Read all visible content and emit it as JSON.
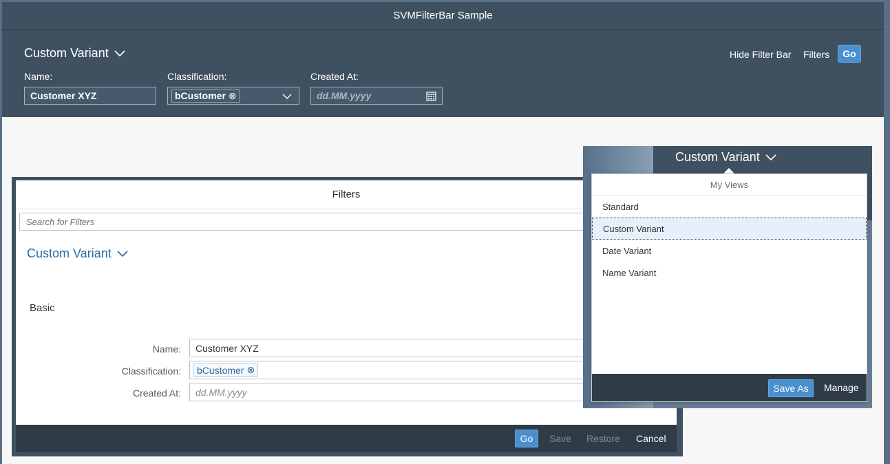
{
  "window": {
    "title": "SVMFilterBar Sample"
  },
  "filterbar": {
    "variant_label": "Custom Variant",
    "hide_filter_bar": "Hide Filter Bar",
    "filters": "Filters",
    "go": "Go",
    "fields": {
      "name_label": "Name:",
      "name_value": "Customer XYZ",
      "classification_label": "Classification:",
      "classification_token": "bCustomer",
      "created_label": "Created At:",
      "created_placeholder": "dd.MM.yyyy"
    }
  },
  "dialog": {
    "title": "Filters",
    "search_placeholder": "Search for Filters",
    "variant_label": "Custom Variant",
    "group": "Basic",
    "fields": {
      "name_label": "Name:",
      "name_value": "Customer XYZ",
      "classification_label": "Classification:",
      "classification_token": "bCustomer",
      "created_label": "Created At:",
      "created_placeholder": "dd.MM.yyyy"
    },
    "footer": {
      "go": "Go",
      "save": "Save",
      "restore": "Restore",
      "cancel": "Cancel"
    }
  },
  "popover": {
    "host_variant_label": "Custom Variant",
    "title": "My Views",
    "items": [
      "Standard",
      "Custom Variant",
      "Date Variant",
      "Name Variant"
    ],
    "selected": "Custom Variant",
    "save_as": "Save As",
    "manage": "Manage"
  },
  "icons": {
    "chevron": "chevron-down-icon",
    "clear": "clear-token-icon",
    "calendar": "calendar-icon"
  },
  "colors": {
    "header": "#3f5161",
    "accent": "#4a8fcf",
    "link_blue": "#2b6a9e",
    "footer": "#2f3c48"
  }
}
